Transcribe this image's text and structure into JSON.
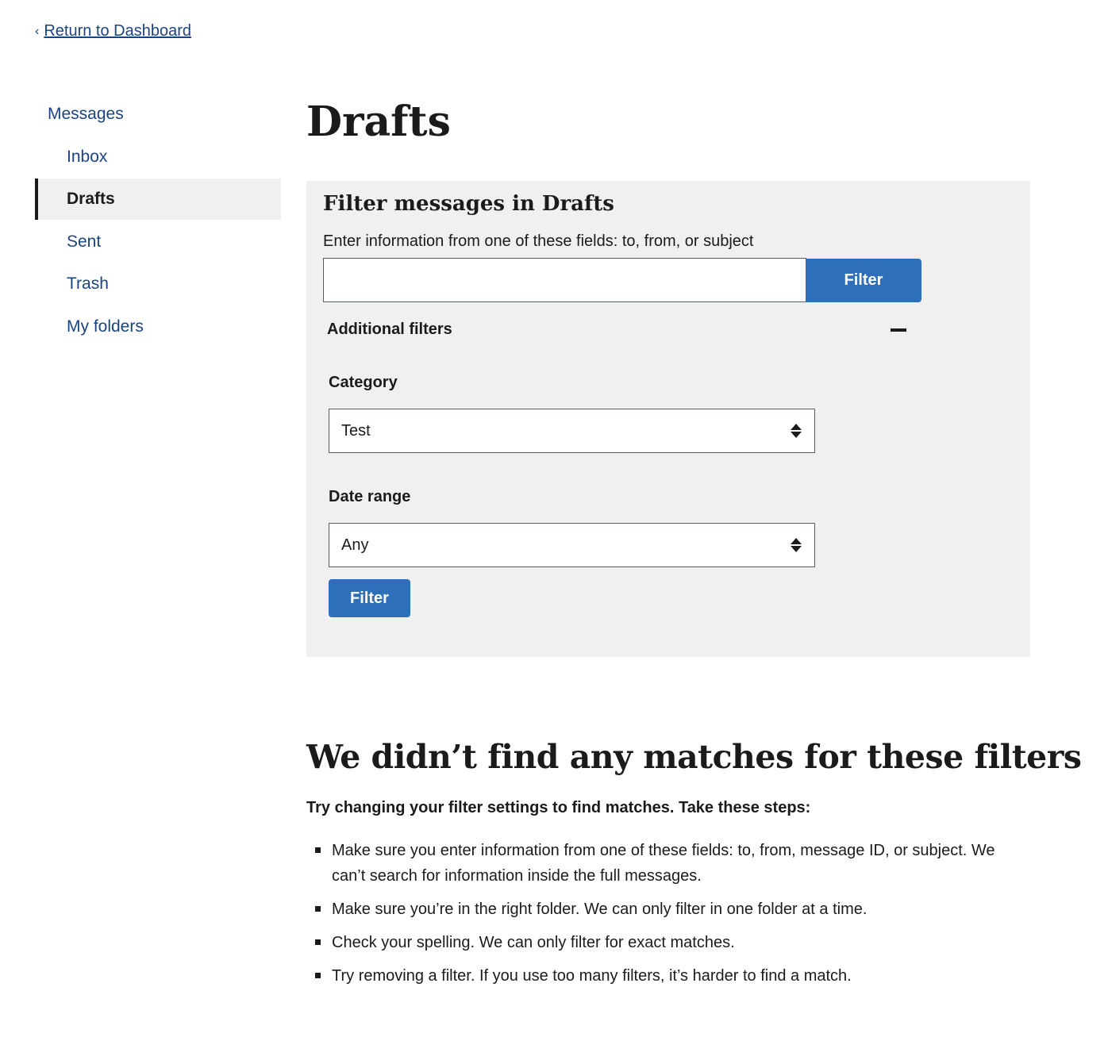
{
  "back_link": {
    "label": "Return to Dashboard"
  },
  "sidenav": {
    "parent": "Messages",
    "items": [
      {
        "label": "Inbox",
        "current": false
      },
      {
        "label": "Drafts",
        "current": true
      },
      {
        "label": "Sent",
        "current": false
      },
      {
        "label": "Trash",
        "current": false
      },
      {
        "label": "My folders",
        "current": false
      }
    ]
  },
  "page": {
    "title": "Drafts"
  },
  "filter": {
    "heading": "Filter messages in Drafts",
    "hint": "Enter information from one of these fields: to, from, or subject",
    "search_value": "",
    "button_label": "Filter",
    "additional_filters_label": "Additional filters",
    "additional_filters_expanded": true,
    "category_label": "Category",
    "category_value": "Test",
    "date_range_label": "Date range",
    "date_range_value": "Any",
    "apply_button_label": "Filter"
  },
  "no_results": {
    "heading": "We didn’t find any matches for these filters",
    "lead": "Try changing your filter settings to find matches. Take these steps:",
    "tips": [
      "Make sure you enter information from one of these fields: to, from, message ID, or subject. We can’t search for information inside the full messages.",
      "Make sure you’re in the right folder. We can only filter in one folder at a time.",
      "Check your spelling. We can only filter for exact matches.",
      "Try removing a filter. If you use too many filters, it’s harder to find a match."
    ]
  },
  "colors": {
    "link": "#1a4480",
    "primary_button": "#2e6fb9",
    "panel_background": "#f0f0f0",
    "text": "#1b1b1b"
  },
  "icons": [
    "chevron-left-icon",
    "minus-icon",
    "sort-arrows-icon",
    "square-bullet-icon"
  ]
}
